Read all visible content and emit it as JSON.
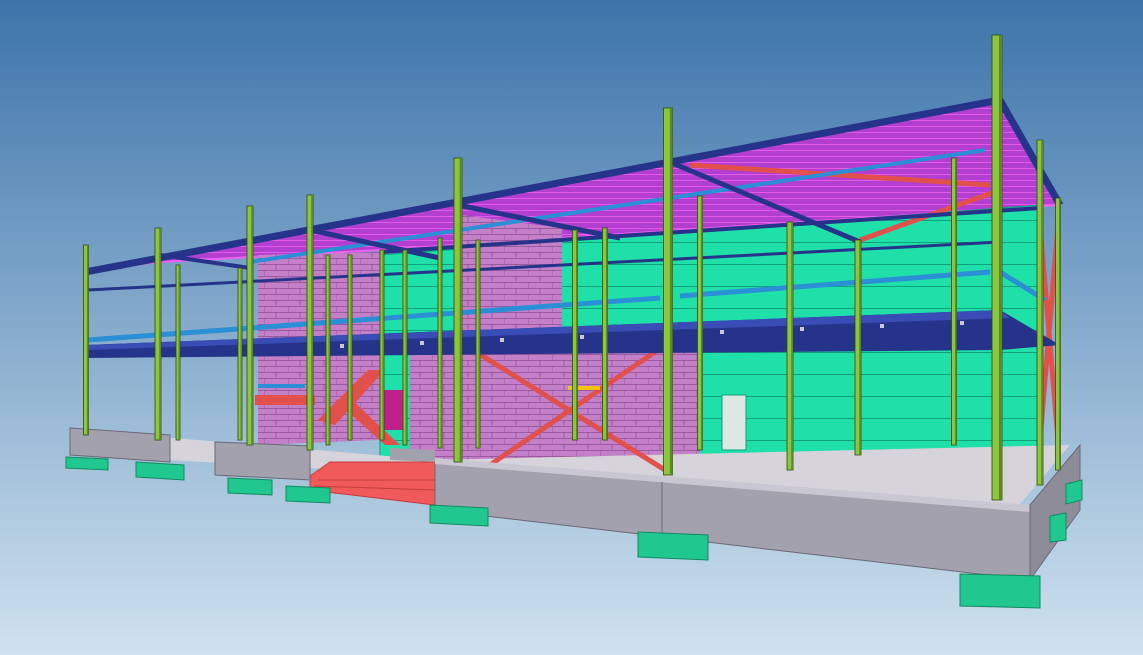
{
  "scene": {
    "subject": "steel-frame-building-model",
    "background_top": "#3d74aa",
    "background_bottom": "#cfe2ef"
  },
  "colors": {
    "column": "#8cc63f",
    "column_dark": "#5b8a22",
    "column_edge": "#2f4a10",
    "beam_navy": "#26338a",
    "beam_navy_light": "#3a4cb5",
    "beam_blue": "#2b8fd6",
    "brace_red": "#e2504c",
    "roof_magenta": "#b23fd0",
    "roof_magenta_line": "#f060f0",
    "masonry": "#c47fc9",
    "masonry_line": "#8e4f93",
    "cladding_teal": "#1ee0a8",
    "cladding_teal_line": "#10a07a",
    "foundation": "#a4a1ae",
    "foundation_top": "#c9c7d2",
    "footing": "#20c890",
    "slab": "#d6d3da",
    "stair_red": "#f05a5a",
    "yellow_beam": "#f2c40c",
    "door_magenta": "#c0208a"
  }
}
